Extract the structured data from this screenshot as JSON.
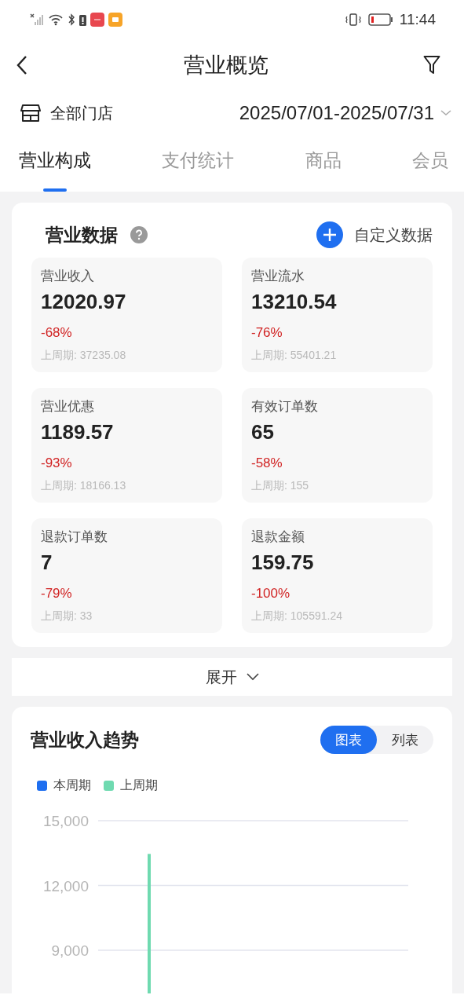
{
  "status_bar": {
    "time": "11:44"
  },
  "header": {
    "title": "营业概览"
  },
  "filter_row": {
    "store": "全部门店",
    "date_range": "2025/07/01-2025/07/31"
  },
  "tabs": [
    {
      "label": "营业构成",
      "selected": true
    },
    {
      "label": "支付统计",
      "selected": false
    },
    {
      "label": "商品",
      "selected": false
    },
    {
      "label": "会员",
      "selected": false
    }
  ],
  "business_data": {
    "title": "营业数据",
    "custom_button": "自定义数据",
    "metrics": [
      {
        "label": "营业收入",
        "value": "12020.97",
        "change": "-68%",
        "previous": "上周期: 37235.08"
      },
      {
        "label": "营业流水",
        "value": "13210.54",
        "change": "-76%",
        "previous": "上周期: 55401.21"
      },
      {
        "label": "营业优惠",
        "value": "1189.57",
        "change": "-93%",
        "previous": "上周期: 18166.13"
      },
      {
        "label": "有效订单数",
        "value": "65",
        "change": "-58%",
        "previous": "上周期: 155"
      },
      {
        "label": "退款订单数",
        "value": "7",
        "change": "-79%",
        "previous": "上周期: 33"
      },
      {
        "label": "退款金额",
        "value": "159.75",
        "change": "-100%",
        "previous": "上周期: 105591.24"
      }
    ]
  },
  "expand": {
    "label": "展开"
  },
  "trend": {
    "title": "营业收入趋势",
    "view_toggle": [
      {
        "label": "图表",
        "selected": true
      },
      {
        "label": "列表",
        "selected": false
      }
    ],
    "chart_data": {
      "type": "bar",
      "ylim": [
        7000,
        15000
      ],
      "yticks": [
        {
          "value": 9000,
          "label": "9,000"
        },
        {
          "value": 12000,
          "label": "12,000"
        },
        {
          "value": 15000,
          "label": "15,000"
        }
      ],
      "series": [
        {
          "name": "本周期",
          "color": "#1f6ff0",
          "values": [
            null
          ]
        },
        {
          "name": "上周期",
          "color": "#6fdab0",
          "values": [
            13460
          ]
        }
      ]
    }
  }
}
